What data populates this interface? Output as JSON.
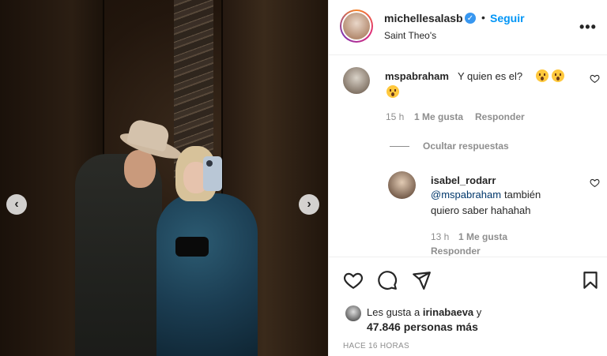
{
  "post": {
    "username": "michellesalasb",
    "follow_label": "Seguir",
    "location": "Saint Theo's",
    "more_label": "•••"
  },
  "comments": {
    "c1": {
      "user": "mspabraham",
      "text": "Y quien es el?",
      "time": "15 h",
      "likes": "1 Me gusta",
      "reply_label": "Responder"
    },
    "hide_replies_label": "Ocultar respuestas",
    "c2": {
      "user": "isabel_rodarr",
      "mention": "@mspabraham",
      "text_part1": "también",
      "text_part2": "quiero saber hahahah",
      "time": "13 h",
      "likes": "1 Me gusta",
      "reply_label": "Responder"
    }
  },
  "likes": {
    "prefix": "Les gusta a",
    "liked_by": "irinabaeva",
    "suffix": "y",
    "others": "47.846 personas más"
  },
  "time_ago": "HACE 16 HORAS",
  "icons": [
    "heart-icon",
    "comment-icon",
    "share-icon",
    "bookmark-icon",
    "verified-icon",
    "chevron-left-icon",
    "chevron-right-icon",
    "more-icon"
  ],
  "colors": {
    "link": "#0095f6",
    "mention": "#00376b",
    "muted": "#8e8e8e",
    "verified": "#3897f0"
  }
}
